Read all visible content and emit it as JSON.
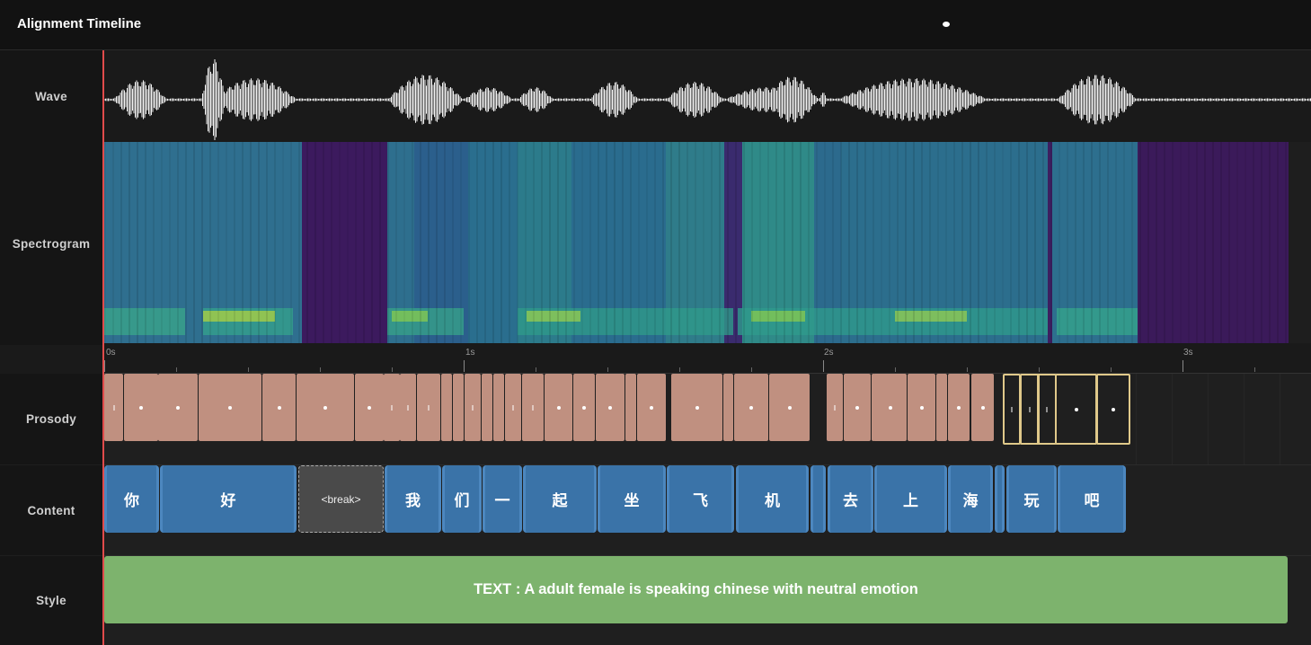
{
  "app": {
    "title": "Alignment Timeline"
  },
  "tracks": {
    "wave_label": "Wave",
    "spectrogram_label": "Spectrogram",
    "prosody_label": "Prosody",
    "content_label": "Content",
    "style_label": "Style"
  },
  "ruler": {
    "ticks": [
      "0s",
      "1s",
      "2s",
      "3s"
    ]
  },
  "content": {
    "tokens": [
      "你",
      "好",
      "<break>",
      "我",
      "们",
      "一",
      "起",
      "坐",
      "飞",
      "机",
      "",
      "去",
      "上",
      "海",
      "",
      "玩",
      "吧"
    ]
  },
  "style": {
    "text": "TEXT : A adult female is speaking chinese with neutral emotion"
  },
  "colors": {
    "prosody": "#c09080",
    "prosody_selected": "#e0c98a",
    "content": "#3a73a8",
    "style": "#7db36d",
    "playhead": "#e04b4b"
  }
}
